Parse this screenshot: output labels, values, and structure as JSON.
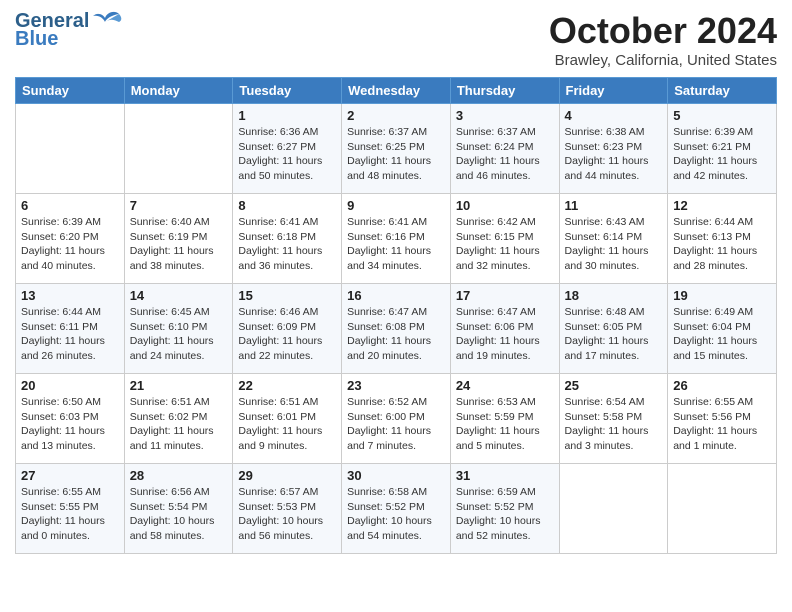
{
  "logo": {
    "line1": "General",
    "line2": "Blue"
  },
  "header": {
    "title": "October 2024",
    "subtitle": "Brawley, California, United States"
  },
  "weekdays": [
    "Sunday",
    "Monday",
    "Tuesday",
    "Wednesday",
    "Thursday",
    "Friday",
    "Saturday"
  ],
  "weeks": [
    [
      {
        "day": "",
        "info": ""
      },
      {
        "day": "",
        "info": ""
      },
      {
        "day": "1",
        "info": "Sunrise: 6:36 AM\nSunset: 6:27 PM\nDaylight: 11 hours\nand 50 minutes."
      },
      {
        "day": "2",
        "info": "Sunrise: 6:37 AM\nSunset: 6:25 PM\nDaylight: 11 hours\nand 48 minutes."
      },
      {
        "day": "3",
        "info": "Sunrise: 6:37 AM\nSunset: 6:24 PM\nDaylight: 11 hours\nand 46 minutes."
      },
      {
        "day": "4",
        "info": "Sunrise: 6:38 AM\nSunset: 6:23 PM\nDaylight: 11 hours\nand 44 minutes."
      },
      {
        "day": "5",
        "info": "Sunrise: 6:39 AM\nSunset: 6:21 PM\nDaylight: 11 hours\nand 42 minutes."
      }
    ],
    [
      {
        "day": "6",
        "info": "Sunrise: 6:39 AM\nSunset: 6:20 PM\nDaylight: 11 hours\nand 40 minutes."
      },
      {
        "day": "7",
        "info": "Sunrise: 6:40 AM\nSunset: 6:19 PM\nDaylight: 11 hours\nand 38 minutes."
      },
      {
        "day": "8",
        "info": "Sunrise: 6:41 AM\nSunset: 6:18 PM\nDaylight: 11 hours\nand 36 minutes."
      },
      {
        "day": "9",
        "info": "Sunrise: 6:41 AM\nSunset: 6:16 PM\nDaylight: 11 hours\nand 34 minutes."
      },
      {
        "day": "10",
        "info": "Sunrise: 6:42 AM\nSunset: 6:15 PM\nDaylight: 11 hours\nand 32 minutes."
      },
      {
        "day": "11",
        "info": "Sunrise: 6:43 AM\nSunset: 6:14 PM\nDaylight: 11 hours\nand 30 minutes."
      },
      {
        "day": "12",
        "info": "Sunrise: 6:44 AM\nSunset: 6:13 PM\nDaylight: 11 hours\nand 28 minutes."
      }
    ],
    [
      {
        "day": "13",
        "info": "Sunrise: 6:44 AM\nSunset: 6:11 PM\nDaylight: 11 hours\nand 26 minutes."
      },
      {
        "day": "14",
        "info": "Sunrise: 6:45 AM\nSunset: 6:10 PM\nDaylight: 11 hours\nand 24 minutes."
      },
      {
        "day": "15",
        "info": "Sunrise: 6:46 AM\nSunset: 6:09 PM\nDaylight: 11 hours\nand 22 minutes."
      },
      {
        "day": "16",
        "info": "Sunrise: 6:47 AM\nSunset: 6:08 PM\nDaylight: 11 hours\nand 20 minutes."
      },
      {
        "day": "17",
        "info": "Sunrise: 6:47 AM\nSunset: 6:06 PM\nDaylight: 11 hours\nand 19 minutes."
      },
      {
        "day": "18",
        "info": "Sunrise: 6:48 AM\nSunset: 6:05 PM\nDaylight: 11 hours\nand 17 minutes."
      },
      {
        "day": "19",
        "info": "Sunrise: 6:49 AM\nSunset: 6:04 PM\nDaylight: 11 hours\nand 15 minutes."
      }
    ],
    [
      {
        "day": "20",
        "info": "Sunrise: 6:50 AM\nSunset: 6:03 PM\nDaylight: 11 hours\nand 13 minutes."
      },
      {
        "day": "21",
        "info": "Sunrise: 6:51 AM\nSunset: 6:02 PM\nDaylight: 11 hours\nand 11 minutes."
      },
      {
        "day": "22",
        "info": "Sunrise: 6:51 AM\nSunset: 6:01 PM\nDaylight: 11 hours\nand 9 minutes."
      },
      {
        "day": "23",
        "info": "Sunrise: 6:52 AM\nSunset: 6:00 PM\nDaylight: 11 hours\nand 7 minutes."
      },
      {
        "day": "24",
        "info": "Sunrise: 6:53 AM\nSunset: 5:59 PM\nDaylight: 11 hours\nand 5 minutes."
      },
      {
        "day": "25",
        "info": "Sunrise: 6:54 AM\nSunset: 5:58 PM\nDaylight: 11 hours\nand 3 minutes."
      },
      {
        "day": "26",
        "info": "Sunrise: 6:55 AM\nSunset: 5:56 PM\nDaylight: 11 hours\nand 1 minute."
      }
    ],
    [
      {
        "day": "27",
        "info": "Sunrise: 6:55 AM\nSunset: 5:55 PM\nDaylight: 11 hours\nand 0 minutes."
      },
      {
        "day": "28",
        "info": "Sunrise: 6:56 AM\nSunset: 5:54 PM\nDaylight: 10 hours\nand 58 minutes."
      },
      {
        "day": "29",
        "info": "Sunrise: 6:57 AM\nSunset: 5:53 PM\nDaylight: 10 hours\nand 56 minutes."
      },
      {
        "day": "30",
        "info": "Sunrise: 6:58 AM\nSunset: 5:52 PM\nDaylight: 10 hours\nand 54 minutes."
      },
      {
        "day": "31",
        "info": "Sunrise: 6:59 AM\nSunset: 5:52 PM\nDaylight: 10 hours\nand 52 minutes."
      },
      {
        "day": "",
        "info": ""
      },
      {
        "day": "",
        "info": ""
      }
    ]
  ]
}
